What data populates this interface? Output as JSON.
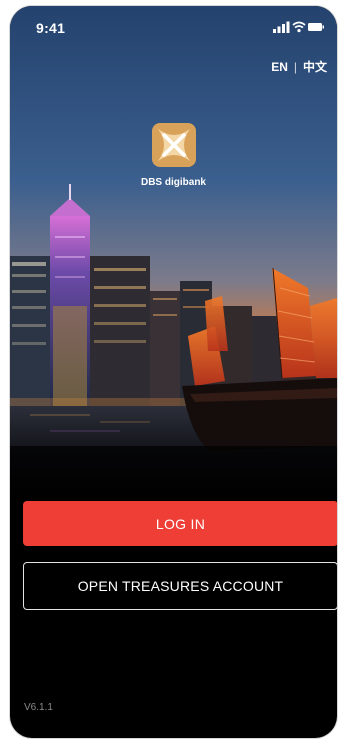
{
  "status_bar": {
    "time": "9:41",
    "icons": [
      "signal-icon",
      "wifi-icon",
      "battery-icon"
    ]
  },
  "language": {
    "current": "EN",
    "separator": "|",
    "alternate": "中文"
  },
  "brand": {
    "name": "DBS digibank",
    "logo_icon": "dbs-star-logo",
    "logo_color": "#d9a25a"
  },
  "actions": {
    "login_label": "LOG IN",
    "login_color": "#ee3e36",
    "open_account_label": "OPEN TREASURES ACCOUNT"
  },
  "footer": {
    "version": "V6.1.1"
  }
}
